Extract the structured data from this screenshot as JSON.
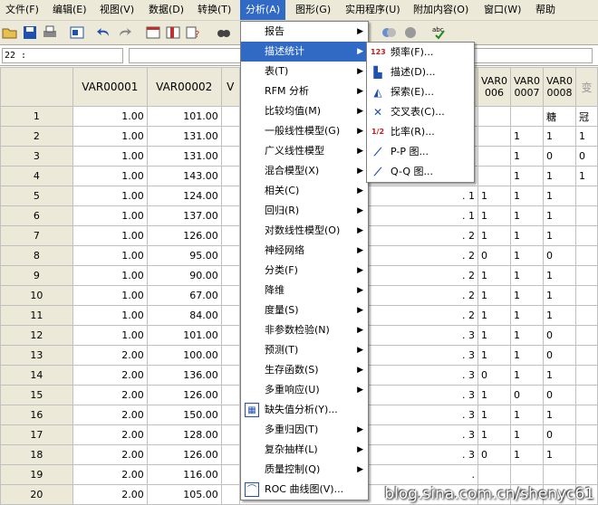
{
  "menubar": [
    {
      "label": "文件(F)"
    },
    {
      "label": "编辑(E)"
    },
    {
      "label": "视图(V)"
    },
    {
      "label": "数据(D)"
    },
    {
      "label": "转换(T)"
    },
    {
      "label": "分析(A)"
    },
    {
      "label": "图形(G)"
    },
    {
      "label": "实用程序(U)"
    },
    {
      "label": "附加内容(O)"
    },
    {
      "label": "窗口(W)"
    },
    {
      "label": "帮助"
    }
  ],
  "cell_ref": "22 :",
  "columns": [
    "VAR00001",
    "VAR00002",
    "V",
    "VAR0 006",
    "VAR0 0007",
    "VAR0 0008",
    "变"
  ],
  "rows": [
    {
      "n": "1",
      "v1": "1.00",
      "v2": "101.00",
      "c5": "",
      "c6": "糖",
      "c7": "冠"
    },
    {
      "n": "2",
      "v1": "1.00",
      "v2": "131.00",
      "c4": "",
      "c5": "1",
      "c6": "1",
      "c7": "1"
    },
    {
      "n": "3",
      "v1": "1.00",
      "v2": "131.00",
      "c5": "1",
      "c6": "0",
      "c7": "0"
    },
    {
      "n": "4",
      "v1": "1.00",
      "v2": "143.00",
      "c5": "1",
      "c6": "1",
      "c7": "1"
    },
    {
      "n": "5",
      "v1": "1.00",
      "v2": "124.00",
      "c3": ". 1",
      "c4": "1",
      "c5": "1",
      "c6": "1"
    },
    {
      "n": "6",
      "v1": "1.00",
      "v2": "137.00",
      "c3": ". 1",
      "c4": "1",
      "c5": "1",
      "c6": "1"
    },
    {
      "n": "7",
      "v1": "1.00",
      "v2": "126.00",
      "c3": ". 2",
      "c4": "1",
      "c5": "1",
      "c6": "1"
    },
    {
      "n": "8",
      "v1": "1.00",
      "v2": "95.00",
      "c3": ". 2",
      "c4": "0",
      "c5": "1",
      "c6": "0"
    },
    {
      "n": "9",
      "v1": "1.00",
      "v2": "90.00",
      "c3": ". 2",
      "c4": "1",
      "c5": "1",
      "c6": "1"
    },
    {
      "n": "10",
      "v1": "1.00",
      "v2": "67.00",
      "c3": ". 2",
      "c4": "1",
      "c5": "1",
      "c6": "1"
    },
    {
      "n": "11",
      "v1": "1.00",
      "v2": "84.00",
      "c3": ". 2",
      "c4": "1",
      "c5": "1",
      "c6": "1"
    },
    {
      "n": "12",
      "v1": "1.00",
      "v2": "101.00",
      "c3": ". 3",
      "c4": "1",
      "c5": "1",
      "c6": "0"
    },
    {
      "n": "13",
      "v1": "2.00",
      "v2": "100.00",
      "c3": ". 3",
      "c4": "1",
      "c5": "1",
      "c6": "0"
    },
    {
      "n": "14",
      "v1": "2.00",
      "v2": "136.00",
      "c3": ". 3",
      "c4": "0",
      "c5": "1",
      "c6": "1"
    },
    {
      "n": "15",
      "v1": "2.00",
      "v2": "126.00",
      "c3": ". 3",
      "c4": "1",
      "c5": "0",
      "c6": "0"
    },
    {
      "n": "16",
      "v1": "2.00",
      "v2": "150.00",
      "c3": ". 3",
      "c4": "1",
      "c5": "1",
      "c6": "1"
    },
    {
      "n": "17",
      "v1": "2.00",
      "v2": "128.00",
      "c3": ". 3",
      "c4": "1",
      "c5": "1",
      "c6": "0"
    },
    {
      "n": "18",
      "v1": "2.00",
      "v2": "126.00",
      "c3": ". 3",
      "c4": "0",
      "c5": "1",
      "c6": "1"
    },
    {
      "n": "19",
      "v1": "2.00",
      "v2": "116.00",
      "c3": ".",
      "c4": "",
      "c5": "",
      "c6": ""
    },
    {
      "n": "20",
      "v1": "2.00",
      "v2": "105.00",
      "c3": "",
      "c4": "",
      "c5": "",
      "c6": ""
    }
  ],
  "analyze_menu": [
    {
      "label": "报告",
      "sub": true
    },
    {
      "label": "描述统计",
      "sub": true,
      "hl": true
    },
    {
      "label": "表(T)",
      "sub": true
    },
    {
      "label": "RFM 分析",
      "sub": true
    },
    {
      "label": "比较均值(M)",
      "sub": true
    },
    {
      "label": "一般线性模型(G)",
      "sub": true
    },
    {
      "label": "广义线性模型",
      "sub": true
    },
    {
      "label": "混合模型(X)",
      "sub": true
    },
    {
      "label": "相关(C)",
      "sub": true
    },
    {
      "label": "回归(R)",
      "sub": true
    },
    {
      "label": "对数线性模型(O)",
      "sub": true
    },
    {
      "label": "神经网络",
      "sub": true
    },
    {
      "label": "分类(F)",
      "sub": true
    },
    {
      "label": "降维",
      "sub": true
    },
    {
      "label": "度量(S)",
      "sub": true
    },
    {
      "label": "非参数检验(N)",
      "sub": true
    },
    {
      "label": "预测(T)",
      "sub": true
    },
    {
      "label": "生存函数(S)",
      "sub": true
    },
    {
      "label": "多重响应(U)",
      "sub": true
    },
    {
      "label": "缺失值分析(Y)...",
      "sub": false,
      "icon": "missing-values-icon"
    },
    {
      "label": "多重归因(T)",
      "sub": true
    },
    {
      "label": "复杂抽样(L)",
      "sub": true
    },
    {
      "label": "质量控制(Q)",
      "sub": true
    },
    {
      "label": "ROC 曲线图(V)...",
      "sub": false,
      "icon": "roc-curve-icon"
    }
  ],
  "desc_submenu": [
    {
      "label": "频率(F)...",
      "icon": "frequencies-icon",
      "glyph": "123"
    },
    {
      "label": "描述(D)...",
      "icon": "descriptives-icon",
      "glyph": "▙"
    },
    {
      "label": "探索(E)...",
      "icon": "explore-icon",
      "glyph": "◭"
    },
    {
      "label": "交叉表(C)...",
      "icon": "crosstabs-icon",
      "glyph": "✕"
    },
    {
      "label": "比率(R)...",
      "icon": "ratio-icon",
      "glyph": "1/2"
    },
    {
      "label": "P-P 图...",
      "icon": "pp-plot-icon",
      "glyph": "⟋"
    },
    {
      "label": "Q-Q 图...",
      "icon": "qq-plot-icon",
      "glyph": "⟋"
    }
  ],
  "watermark": "blog.sina.com.cn/shenyc61",
  "colors": {
    "menu_highlight": "#316ac5",
    "chrome": "#ece9d8"
  }
}
